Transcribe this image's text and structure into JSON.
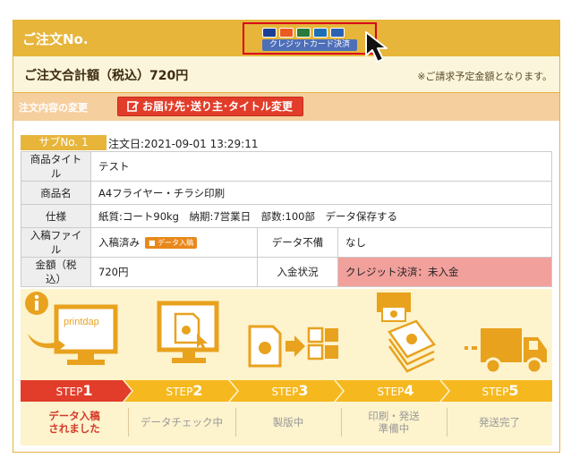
{
  "header": {
    "title": "ご注文No.",
    "cc_button_label": "クレジットカード決済"
  },
  "total": {
    "title": "ご注文合計額（税込）720円",
    "note": "※ご請求予定金額となります。"
  },
  "change": {
    "label": "注文内容の変更",
    "button_label": "お届け先･送り主･タイトル変更"
  },
  "sub": {
    "label": "サブNo. 1",
    "order_date": "注文日:2021-09-01 13:29:11"
  },
  "info": {
    "title_label": "商品タイトル",
    "title_value": "テスト",
    "name_label": "商品名",
    "name_value": "A4フライヤー・チラシ印刷",
    "spec_label": "仕様",
    "spec_value": "紙質:コート90kg　納期:7営業日　部数:100部　データ保存する",
    "file_label": "入稿ファイル",
    "file_value": "入稿済み",
    "file_badge": "データ入稿",
    "defect_label": "データ不備",
    "defect_value": "なし",
    "amount_label": "金額（税込）",
    "amount_value": "720円",
    "payment_label": "入金状況",
    "payment_value": "クレジット決済：未入金"
  },
  "steps": {
    "logo_text": "printdap",
    "items": [
      {
        "prefix": "STEP",
        "num": "1",
        "status_line1": "データ入稿",
        "status_line2": "されました"
      },
      {
        "prefix": "STEP",
        "num": "2",
        "status_line1": "データチェック中",
        "status_line2": ""
      },
      {
        "prefix": "STEP",
        "num": "3",
        "status_line1": "製版中",
        "status_line2": ""
      },
      {
        "prefix": "STEP",
        "num": "4",
        "status_line1": "印刷・発送",
        "status_line2": "準備中"
      },
      {
        "prefix": "STEP",
        "num": "5",
        "status_line1": "発送完了",
        "status_line2": ""
      }
    ]
  },
  "colors": {
    "accent": "#e6b53a",
    "step_active": "#e23d2a",
    "step_inactive": "#f5b81f",
    "warn_cell": "#f2a09c"
  }
}
